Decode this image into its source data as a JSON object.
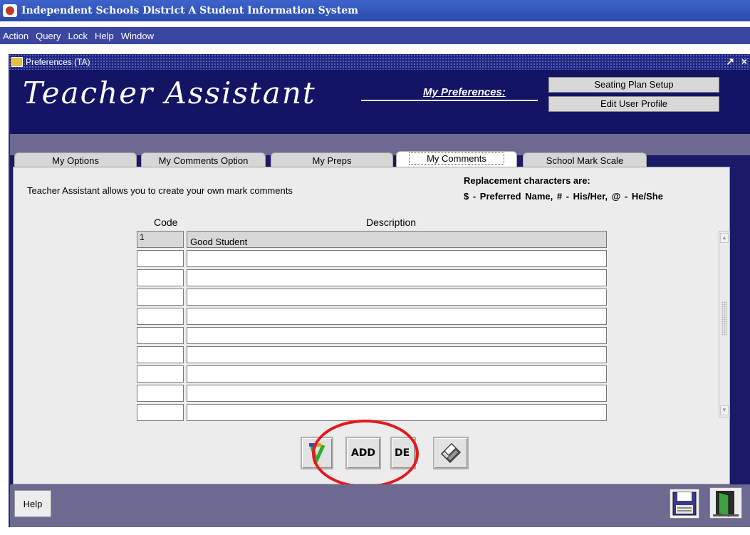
{
  "window": {
    "title": "Independent Schools District A Student Information System"
  },
  "menu": [
    "Action",
    "Query",
    "Lock",
    "Help",
    "Window"
  ],
  "inner_window": {
    "title": "Preferences (TA)",
    "controls": [
      "↗",
      "×"
    ]
  },
  "header": {
    "brand": "Teacher Assistant",
    "preferences_label": "My Preferences:",
    "buttons": [
      "Seating Plan Setup",
      "Edit User Profile"
    ]
  },
  "tabs": [
    "My Options",
    "My Comments Option",
    "My Preps",
    "My Comments",
    "School Mark Scale"
  ],
  "active_tab": "My Comments",
  "panel": {
    "intro": "Teacher Assistant allows you to create your own mark comments",
    "replacement_title": "Replacement characters are:",
    "replacement_chars": "$ - Preferred Name,  # - His/Her,   @ - He/She",
    "columns": {
      "code": "Code",
      "description": "Description"
    },
    "rows": [
      {
        "code": "1",
        "description": "Good Student"
      },
      {
        "code": "",
        "description": ""
      },
      {
        "code": "",
        "description": ""
      },
      {
        "code": "",
        "description": ""
      },
      {
        "code": "",
        "description": ""
      },
      {
        "code": "",
        "description": ""
      },
      {
        "code": "",
        "description": ""
      },
      {
        "code": "",
        "description": ""
      },
      {
        "code": "",
        "description": ""
      },
      {
        "code": "",
        "description": ""
      }
    ]
  },
  "toolbar": {
    "add_label": "ADD",
    "delete_label": "DE"
  },
  "footer": {
    "help_label": "Help"
  },
  "colors": {
    "titlebar": "#2a4aa8",
    "header_band": "#141464",
    "tab_band": "#6c6a90",
    "highlight_circle": "#e8181a"
  },
  "icons": [
    "app-icon",
    "form-icon",
    "spellcheck-icon",
    "printer-icon",
    "save-icon",
    "exit-door-icon"
  ]
}
